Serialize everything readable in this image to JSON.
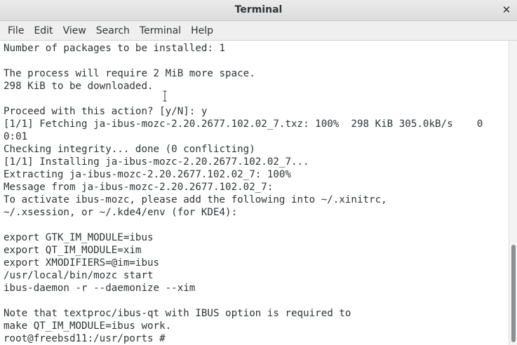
{
  "window": {
    "title": "Terminal",
    "close_glyph": "✕"
  },
  "menu": [
    "File",
    "Edit",
    "View",
    "Search",
    "Terminal",
    "Help"
  ],
  "terminal_lines": [
    "Number of packages to be installed: 1",
    "",
    "The process will require 2 MiB more space.",
    "298 KiB to be downloaded.",
    "",
    "Proceed with this action? [y/N]: y",
    "[1/1] Fetching ja-ibus-mozc-2.20.2677.102.02_7.txz: 100%  298 KiB 305.0kB/s    0",
    "0:01",
    "Checking integrity... done (0 conflicting)",
    "[1/1] Installing ja-ibus-mozc-2.20.2677.102.02_7...",
    "Extracting ja-ibus-mozc-2.20.2677.102.02_7: 100%",
    "Message from ja-ibus-mozc-2.20.2677.102.02_7:",
    "To activate ibus-mozc, please add the following into ~/.xinitrc,",
    "~/.xsession, or ~/.kde4/env (for KDE4):",
    "",
    "export GTK_IM_MODULE=ibus",
    "export QT_IM_MODULE=xim",
    "export XMODIFIERS=@im=ibus",
    "/usr/local/bin/mozc start",
    "ibus-daemon -r --daemonize --xim",
    "",
    "Note that textproc/ibus-qt with IBUS option is required to",
    "make QT_IM_MODULE=ibus work.",
    "root@freebsd11:/usr/ports # "
  ],
  "scrollbar": {
    "position_fraction": 0.67,
    "visible_fraction": 0.32
  },
  "colors": {
    "text": "#2e3436",
    "background": "#ffffff",
    "thumb": "#8a8f91"
  }
}
